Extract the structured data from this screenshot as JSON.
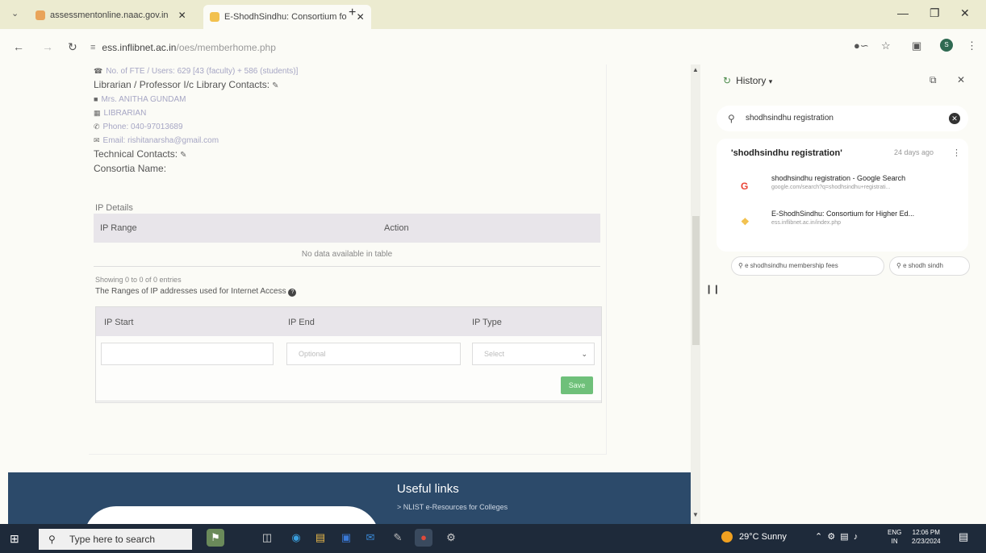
{
  "browser": {
    "tabs": [
      {
        "title": "assessmentonline.naac.gov.in"
      },
      {
        "title": "E-ShodhSindhu: Consortium fo"
      }
    ],
    "new_tab": "+",
    "url_host": "ess.inflibnet.ac.in",
    "url_path": "/oes/memberhome.php"
  },
  "contacts": {
    "fte_line": "No. of FTE / Users: 629 [43 (faculty) + 586 (students)]",
    "librarian_heading": "Librarian / Professor I/c Library Contacts:",
    "name": "Mrs. ANITHA GUNDAM",
    "designation": "LIBRARIAN",
    "phone": "Phone: 040-97013689",
    "email": "Email: rishitanarsha@gmail.com",
    "technical_heading": "Technical Contacts:",
    "consortia_label": "Consortia Name:"
  },
  "ip_details": {
    "title": "IP Details",
    "columns": [
      "IP Range",
      "Action"
    ],
    "empty_message": "No data available in table",
    "showing": "Showing 0 to 0 of 0 entries",
    "ranges_note": "The Ranges of IP addresses used for Internet Access"
  },
  "ip_form": {
    "columns": [
      "IP Start",
      "IP End",
      "IP Type"
    ],
    "ip_start_value": "",
    "ip_end_placeholder": "Optional",
    "ip_type_selected": "Select",
    "save_label": "Save"
  },
  "footer": {
    "title": "Useful links",
    "link": "> NLIST e-Resources for Colleges"
  },
  "history_panel": {
    "title": "History",
    "search_value": "shodhsindhu registration",
    "group_query": "'shodhsindhu registration'",
    "group_time": "24 days ago",
    "items": [
      {
        "title": "shodhsindhu registration - Google Search",
        "url": "google.com/search?q=shodhsindhu+registrati..."
      },
      {
        "title": "E-ShodhSindhu: Consortium for Higher Ed...",
        "url": "ess.inflibnet.ac.in/index.php"
      }
    ],
    "chips": [
      "e shodhsindhu membership fees",
      "e shodh sindh"
    ]
  },
  "taskbar": {
    "search_placeholder": "Type here to search",
    "weather": "29°C  Sunny",
    "lang_top": "ENG",
    "lang_bottom": "IN",
    "time": "12:06 PM",
    "date": "2/23/2024"
  }
}
